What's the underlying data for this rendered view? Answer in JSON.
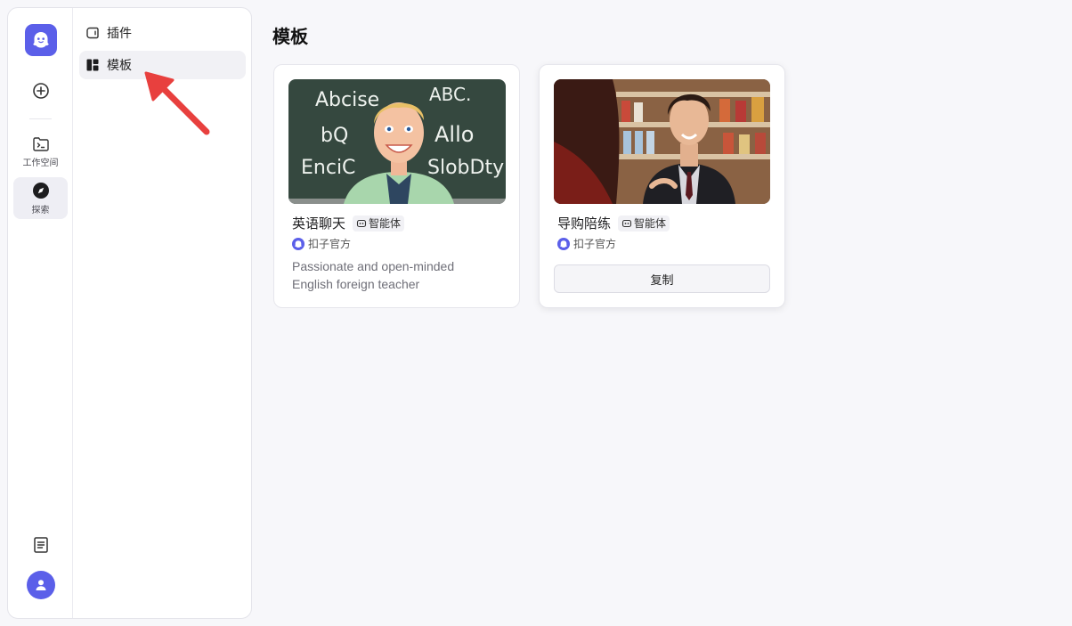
{
  "sidebar": {
    "workspace_label": "工作空间",
    "explore_label": "探索"
  },
  "nav": {
    "items": [
      {
        "label": "插件",
        "icon": "plugin-icon"
      },
      {
        "label": "模板",
        "icon": "template-grid-icon",
        "active": true
      }
    ]
  },
  "main": {
    "title": "模板",
    "cards": [
      {
        "title": "英语聊天",
        "tag": "智能体",
        "author": "扣子官方",
        "description": "Passionate and open-minded English foreign teacher",
        "image_text": [
          "Abcise",
          "ABC.",
          "bQ",
          "Allo",
          "EnciC",
          "SlobDty"
        ]
      },
      {
        "title": "导购陪练",
        "tag": "智能体",
        "author": "扣子官方",
        "button": "复制"
      }
    ]
  },
  "colors": {
    "brand": "#5b5fe9",
    "annotation_arrow": "#e8403e"
  }
}
